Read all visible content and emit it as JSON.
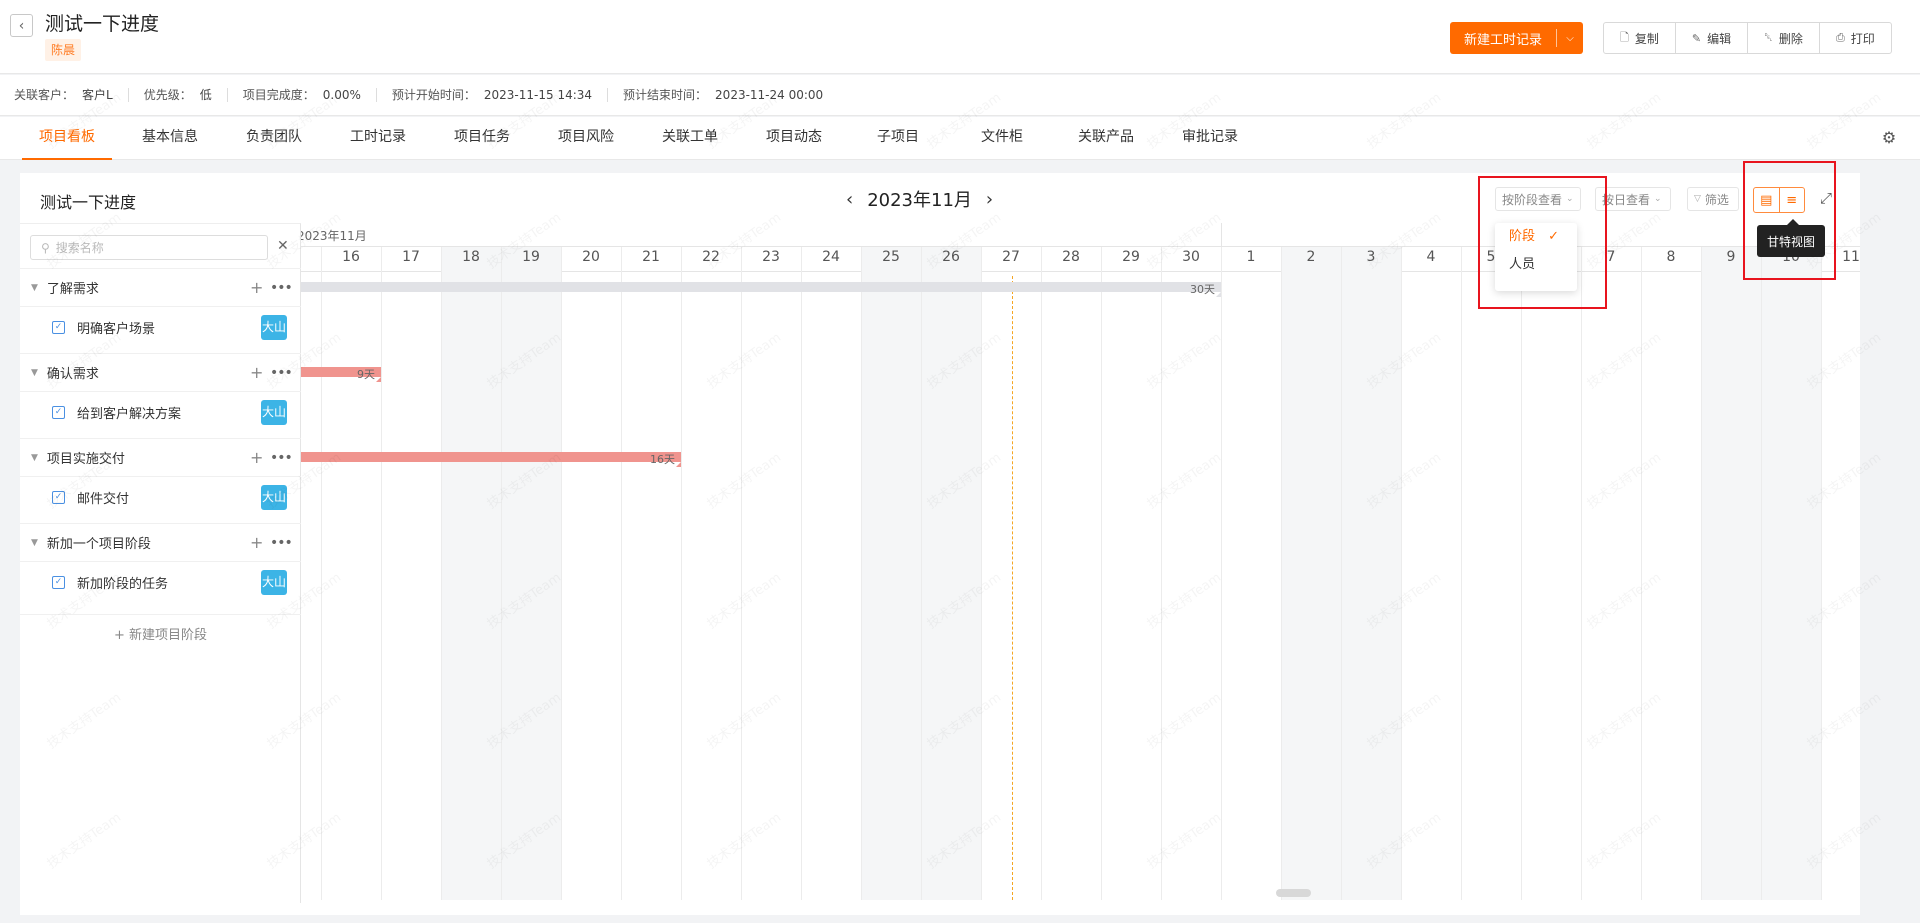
{
  "header": {
    "back_icon": "chevron-left-icon",
    "title": "测试一下进度",
    "owner": "陈晨",
    "new_record_label": "新建工时记录",
    "actions": [
      {
        "label": "复制",
        "icon": "file-icon"
      },
      {
        "label": "编辑",
        "icon": "pen-icon"
      },
      {
        "label": "删除",
        "icon": "trash-icon"
      },
      {
        "label": "打印",
        "icon": "printer-icon"
      }
    ]
  },
  "meta": [
    {
      "label": "关联客户：",
      "value": "客户L"
    },
    {
      "label": "优先级：",
      "value": "低"
    },
    {
      "label": "项目完成度：",
      "value": "0.00%"
    },
    {
      "label": "预计开始时间：",
      "value": "2023-11-15 14:34"
    },
    {
      "label": "预计结束时间：",
      "value": "2023-11-24 00:00"
    }
  ],
  "tabs": [
    "项目看板",
    "基本信息",
    "负责团队",
    "工时记录",
    "项目任务",
    "项目风险",
    "关联工单",
    "项目动态",
    "子项目",
    "文件柜",
    "关联产品",
    "审批记录"
  ],
  "active_tab": "项目看板",
  "board": {
    "title": "测试一下进度",
    "month": "2023年11月",
    "group_select": "按阶段查看",
    "period_select": "按日查看",
    "filter_label": "筛选",
    "search_placeholder": "搜索名称",
    "tooltip": "甘特视图",
    "dropdown_options": [
      "阶段",
      "人员"
    ],
    "dropdown_selected": "阶段",
    "add_stage_label": "+ 新建项目阶段",
    "month_header": "2023年11月"
  },
  "stages": [
    {
      "name": "了解需求",
      "task": "明确客户场景",
      "assignee": "大山",
      "bar_label": "30天",
      "bar_color": "#e1e2e6"
    },
    {
      "name": "确认需求",
      "task": "给到客户解决方案",
      "assignee": "大山",
      "bar_label": "9天",
      "bar_color": "#f0948e"
    },
    {
      "name": "项目实施交付",
      "task": "邮件交付",
      "assignee": "大山",
      "bar_label": "16天",
      "bar_color": "#f0948e"
    },
    {
      "name": "新加一个项目阶段",
      "task": "新加阶段的任务",
      "assignee": "大山"
    }
  ],
  "days": [
    "16",
    "17",
    "18",
    "19",
    "20",
    "21",
    "22",
    "23",
    "24",
    "25",
    "26",
    "27",
    "28",
    "29",
    "30",
    "1",
    "2",
    "3",
    "4",
    "5",
    "6",
    "7",
    "8",
    "9",
    "10",
    "11"
  ],
  "watermark": "技术支持Team 大河",
  "colors": {
    "accent": "#ff6a00",
    "avatar": "#3cb4e6",
    "highlight": "#e8141e",
    "today_line": "#f5a623"
  }
}
